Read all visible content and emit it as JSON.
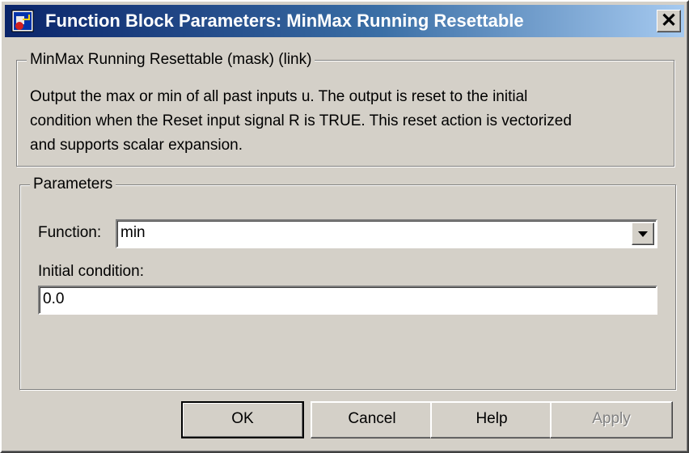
{
  "window": {
    "title": "Function Block Parameters: MinMax Running Resettable",
    "close_glyph": "✕"
  },
  "description_group": {
    "legend": "MinMax Running Resettable (mask) (link)",
    "lines": [
      "Output the max or min of all past inputs u.  The output is reset to the initial",
      "condition when the Reset input signal R is TRUE.  This reset action is vectorized",
      "and supports scalar expansion."
    ]
  },
  "parameters_group": {
    "legend": "Parameters",
    "function_label": "Function:",
    "function_value": "min",
    "initial_condition_label": "Initial condition:",
    "initial_condition_value": "0.0"
  },
  "buttons": {
    "ok": "OK",
    "cancel": "Cancel",
    "help": "Help",
    "apply": "Apply"
  },
  "icons": {
    "app": "simulink-block-icon",
    "close": "close-icon",
    "dropdown": "chevron-down-icon"
  },
  "colors": {
    "title_gradient_start": "#0a246a",
    "title_gradient_end": "#a6caf0",
    "face": "#d4d0c8"
  }
}
